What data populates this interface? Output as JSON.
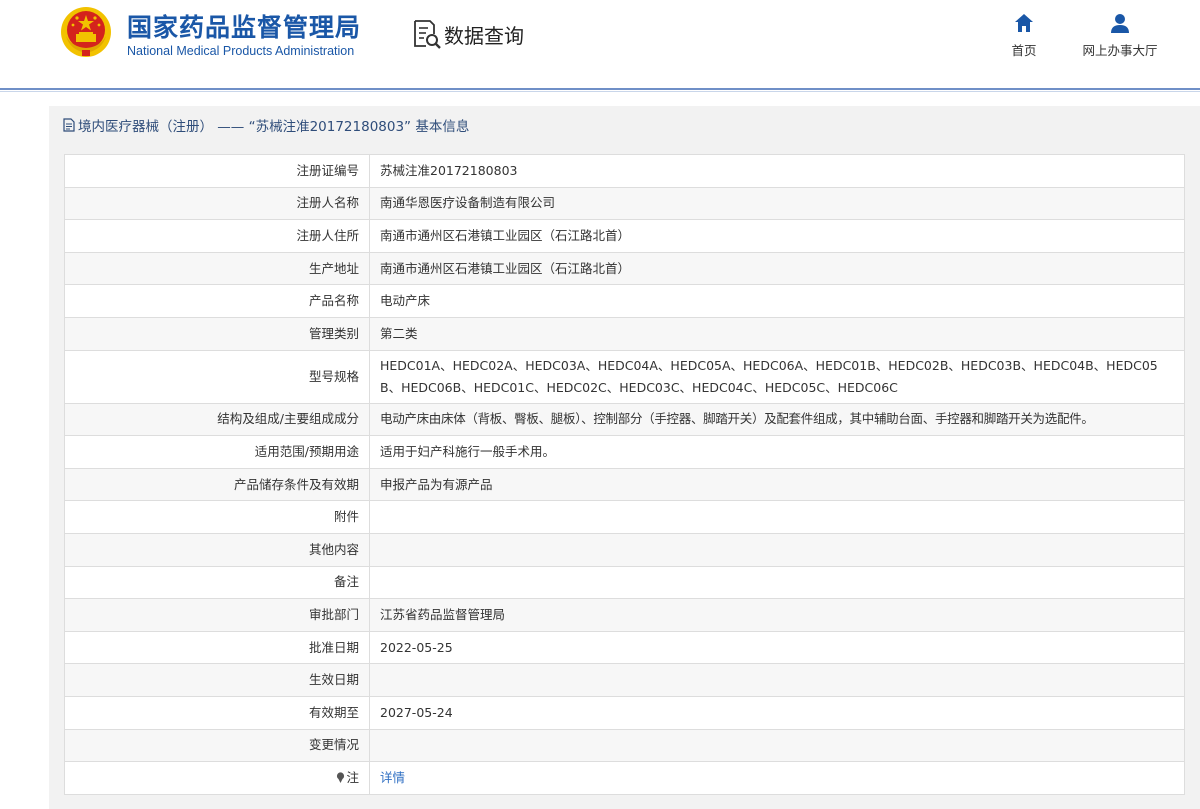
{
  "header": {
    "brand_cn": "国家药品监督管理局",
    "brand_en": "National Medical Products Administration",
    "section": "数据查询",
    "nav": [
      {
        "label": "首页",
        "icon": "home-icon"
      },
      {
        "label": "网上办事大厅",
        "icon": "user-icon"
      }
    ]
  },
  "panel": {
    "title": "境内医疗器械（注册） —— “苏械注准20172180803” 基本信息"
  },
  "rows": [
    {
      "label": "注册证编号",
      "value": "苏械注准20172180803"
    },
    {
      "label": "注册人名称",
      "value": "南通华恩医疗设备制造有限公司"
    },
    {
      "label": "注册人住所",
      "value": "南通市通州区石港镇工业园区（石江路北首）"
    },
    {
      "label": "生产地址",
      "value": "南通市通州区石港镇工业园区（石江路北首）"
    },
    {
      "label": "产品名称",
      "value": "电动产床"
    },
    {
      "label": "管理类别",
      "value": "第二类"
    },
    {
      "label": "型号规格",
      "value": "HEDC01A、HEDC02A、HEDC03A、HEDC04A、HEDC05A、HEDC06A、HEDC01B、HEDC02B、HEDC03B、HEDC04B、HEDC05B、HEDC06B、HEDC01C、HEDC02C、HEDC03C、HEDC04C、HEDC05C、HEDC06C"
    },
    {
      "label": "结构及组成/主要组成成分",
      "value": "电动产床由床体（背板、臀板、腿板）、控制部分（手控器、脚踏开关）及配套件组成，其中辅助台面、手控器和脚踏开关为选配件。"
    },
    {
      "label": "适用范围/预期用途",
      "value": "适用于妇产科施行一般手术用。"
    },
    {
      "label": "产品储存条件及有效期",
      "value": "申报产品为有源产品"
    },
    {
      "label": "附件",
      "value": ""
    },
    {
      "label": "其他内容",
      "value": ""
    },
    {
      "label": "备注",
      "value": ""
    },
    {
      "label": "审批部门",
      "value": "江苏省药品监督管理局"
    },
    {
      "label": "批准日期",
      "value": "2022-05-25"
    },
    {
      "label": "生效日期",
      "value": ""
    },
    {
      "label": "有效期至",
      "value": "2027-05-24"
    },
    {
      "label": "变更情况",
      "value": ""
    }
  ],
  "note_row": {
    "label": "注",
    "link": "详情",
    "icon": "pin-icon"
  },
  "colors": {
    "brand": "#1a57a7",
    "link": "#2f6fc3",
    "panel_bg": "#f2f2f2",
    "emblem_red": "#d4231c",
    "emblem_gold": "#f2c200"
  }
}
